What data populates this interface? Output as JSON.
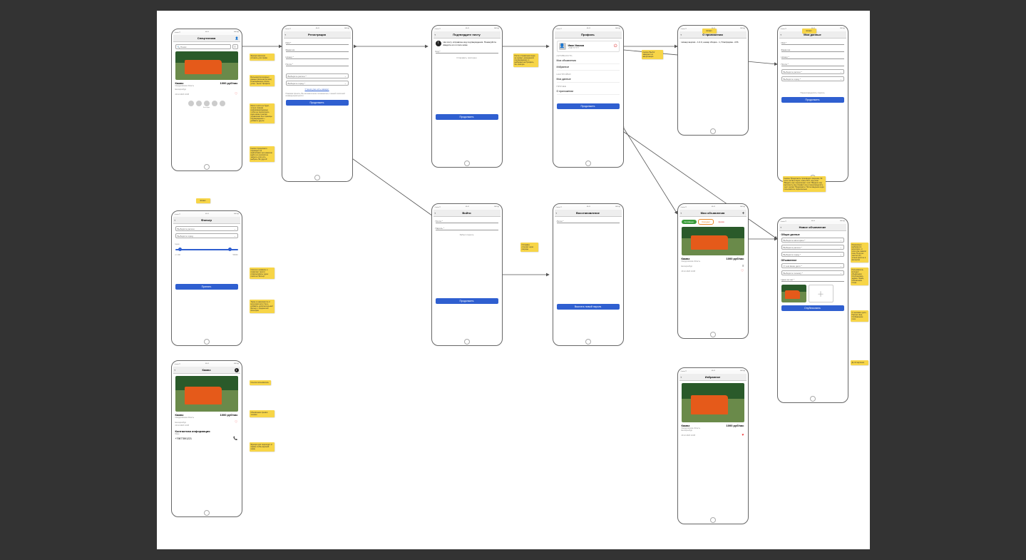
{
  "status": {
    "carrier": "Carrier ᯤ",
    "time": "09:41",
    "batt": "100% ▮"
  },
  "listing": {
    "title": "Камаз",
    "price": "1000 руб/час",
    "region": "Свердловская область",
    "city": "Екатеринбург",
    "date": "20.12.2023 14:08"
  },
  "s1": {
    "title": "Спецтехника",
    "search_ph": "🔍 Поиск"
  },
  "s2": {
    "title": "Регистрация",
    "fields": [
      "Имя *",
      "Фамилия",
      "Номер *",
      "Почта *"
    ],
    "sel1": "Выберите регион *",
    "sel2": "Выберите город *",
    "has_acc": "У меня уже есть аккаунт",
    "terms": "Нажимая принять, Вы автоматически соглашаетесь с нашей политикой конфиденциальности",
    "btn": "Продолжить"
  },
  "s3": {
    "title": "Подтвердите почту",
    "info": "На почту отправлен код подтверждения. Пожалуйста введите его в поле ниже",
    "code": "Код *",
    "resend": "Отправить повторно",
    "btn": "Продолжить"
  },
  "s4": {
    "title": "Профиль",
    "name": "Иван Иванов",
    "phone": "+7987777777",
    "sec1": "АКТИВНОСТЬ",
    "i1": "Мои объявления",
    "i2": "Избранное",
    "sec2": "НАСТРОЙКИ",
    "i3": "Мои данные",
    "sec3": "ПРОЧЕЕ",
    "i4": "О приложении",
    "btn": "Продолжить"
  },
  "s5": {
    "title": "О приложении",
    "body": "Номер версии - 1.0.0, номер сборки - 1, Платформа - iOS"
  },
  "s6": {
    "title": "Мои данные",
    "f1": "Имя *",
    "f2": "Фамилия",
    "f3": "Номер *",
    "f4": "Почта *",
    "sel1": "Выберите регион *",
    "sel2": "Выберите город *",
    "reset": "Переопределить пароль",
    "btn": "Продолжить"
  },
  "s7": {
    "title": "Фильтр",
    "sel1": "Выберите регион",
    "sel2": "Выберите город",
    "price": "Цена",
    "from": "от 100",
    "to": "50000",
    "btn": "Принять"
  },
  "s8": {
    "title": "Войти",
    "f1": "Почта *",
    "f2": "Пароль *",
    "forgot": "Забыл пароль",
    "btn": "Продолжить"
  },
  "s9": {
    "title": "Восстановление",
    "f1": "Логин *",
    "btn": "Выслать новый пароль"
  },
  "s10": {
    "title": "Мои объявления",
    "chips": [
      "Активные",
      "Ожидает",
      "Архив"
    ]
  },
  "s11": {
    "title": "Новое объявление",
    "h1": "Общие данные",
    "sel1": "Выберите категорию *",
    "sel2": "Выберите регион *",
    "sel3": "Выберите город *",
    "h2": "Объявление",
    "sel4": "О чем ваше дело *",
    "sel5": "Выберите технику *",
    "f1": "Цена за час *",
    "btn": "Опубликовать"
  },
  "s12": {
    "title": "Камаз",
    "contact": "Контактная информация",
    "owner": "Иван",
    "phone": "+79877891221"
  },
  "s13": {
    "title": "Избранное"
  },
  "notes": {
    "n1": "Функция фильтра оставить для профи",
    "n2": "Большинство входных данных (включая регион) в выпадающие списки, успех - вылет Профиль",
    "n3": "Много текста не будет, только главная информация/данные чтобы не переполнять один экран и кнопки управления без страницы подтверждения + добавить другое",
    "n4": "Кнопка 'продолжить' переводит на /authorization при нажатии выйти из сессии/стек закрыть если есть выбрать НЕ 'другой'",
    "n5": "После отправления кода на сервер: дожидаемся подтверждения, и выбираем на Профиль, без повтора",
    "n6": "Кнопка 'Выйти' завершит из авторизации",
    "n7": "Штамп",
    "n8": "Штамп",
    "n9": "Штамп",
    "n10": "Список и название и позволяет просто отфильтровать через поиск на 'Фильтр'",
    "n11": "Также в зависимости от категории могут быть добавить дополнительный фильтр с предметной категории",
    "n12": "Кнопка 'Продолжить' производит сверение, 50 если соответствуют, иначе 50.0, код-ответ 'Введите код' переключает текст 'Вводите код' выполнить код отправит код и переопределить текст кнопки 'Продолжить' После введения кода пользователь переключаем",
    "n13": "Отправка отсылки через секунды",
    "n14": "Ссылка пользователь",
    "n15": "Объявление премия техники",
    "n16": "Функция для переходит от экрана чтобы верхний экран",
    "n17": "Изначально выбирается категория, от этого уже зависит поле. В других текстах нет, только простое в фильтров",
    "n18": "Пользователь взглядит объявления: Опубликовать задача: Прайс, Объявление Отказ",
    "n19": "О чем ваше дело, Портрет-вид, Отображение поля",
    "n20": "До 10 картинок"
  }
}
